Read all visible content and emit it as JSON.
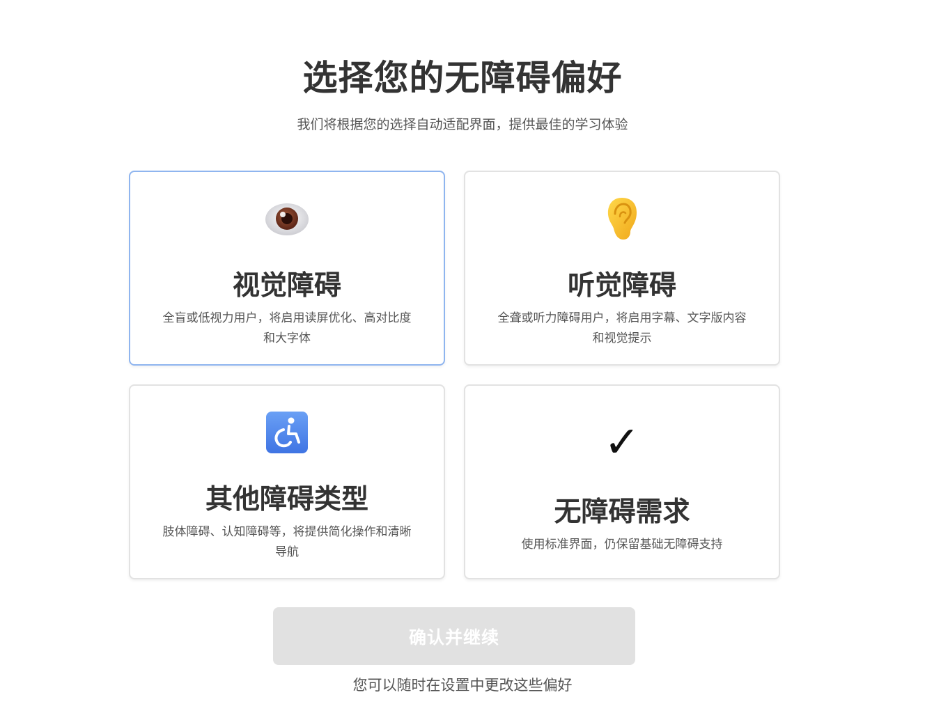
{
  "page": {
    "title": "选择您的无障碍偏好",
    "subtitle": "我们将根据您的选择自动适配界面，提供最佳的学习体验"
  },
  "options": [
    {
      "id": "visual",
      "icon": "eye-icon",
      "title": "视觉障碍",
      "description": "全盲或低视力用户，将启用读屏优化、高对比度和大字体",
      "selected": true
    },
    {
      "id": "hearing",
      "icon": "ear-icon",
      "title": "听觉障碍",
      "description": "全聋或听力障碍用户，将启用字幕、文字版内容和视觉提示",
      "selected": false
    },
    {
      "id": "other",
      "icon": "wheelchair-icon",
      "title": "其他障碍类型",
      "description": "肢体障碍、认知障碍等，将提供简化操作和清晰导航",
      "selected": false
    },
    {
      "id": "none",
      "icon": "checkmark-icon",
      "icon_glyph": "✓",
      "title": "无障碍需求",
      "description": "使用标准界面，仍保留基础无障碍支持",
      "selected": false
    }
  ],
  "confirm_button": {
    "label": "确认并继续",
    "disabled": true
  },
  "footnote": "您可以随时在设置中更改这些偏好",
  "colors": {
    "selected_border": "#8fb5ef",
    "card_border": "#e2e2e2",
    "button_disabled_bg": "#e1e1e1",
    "text_primary": "#333333",
    "text_secondary": "#555555"
  }
}
